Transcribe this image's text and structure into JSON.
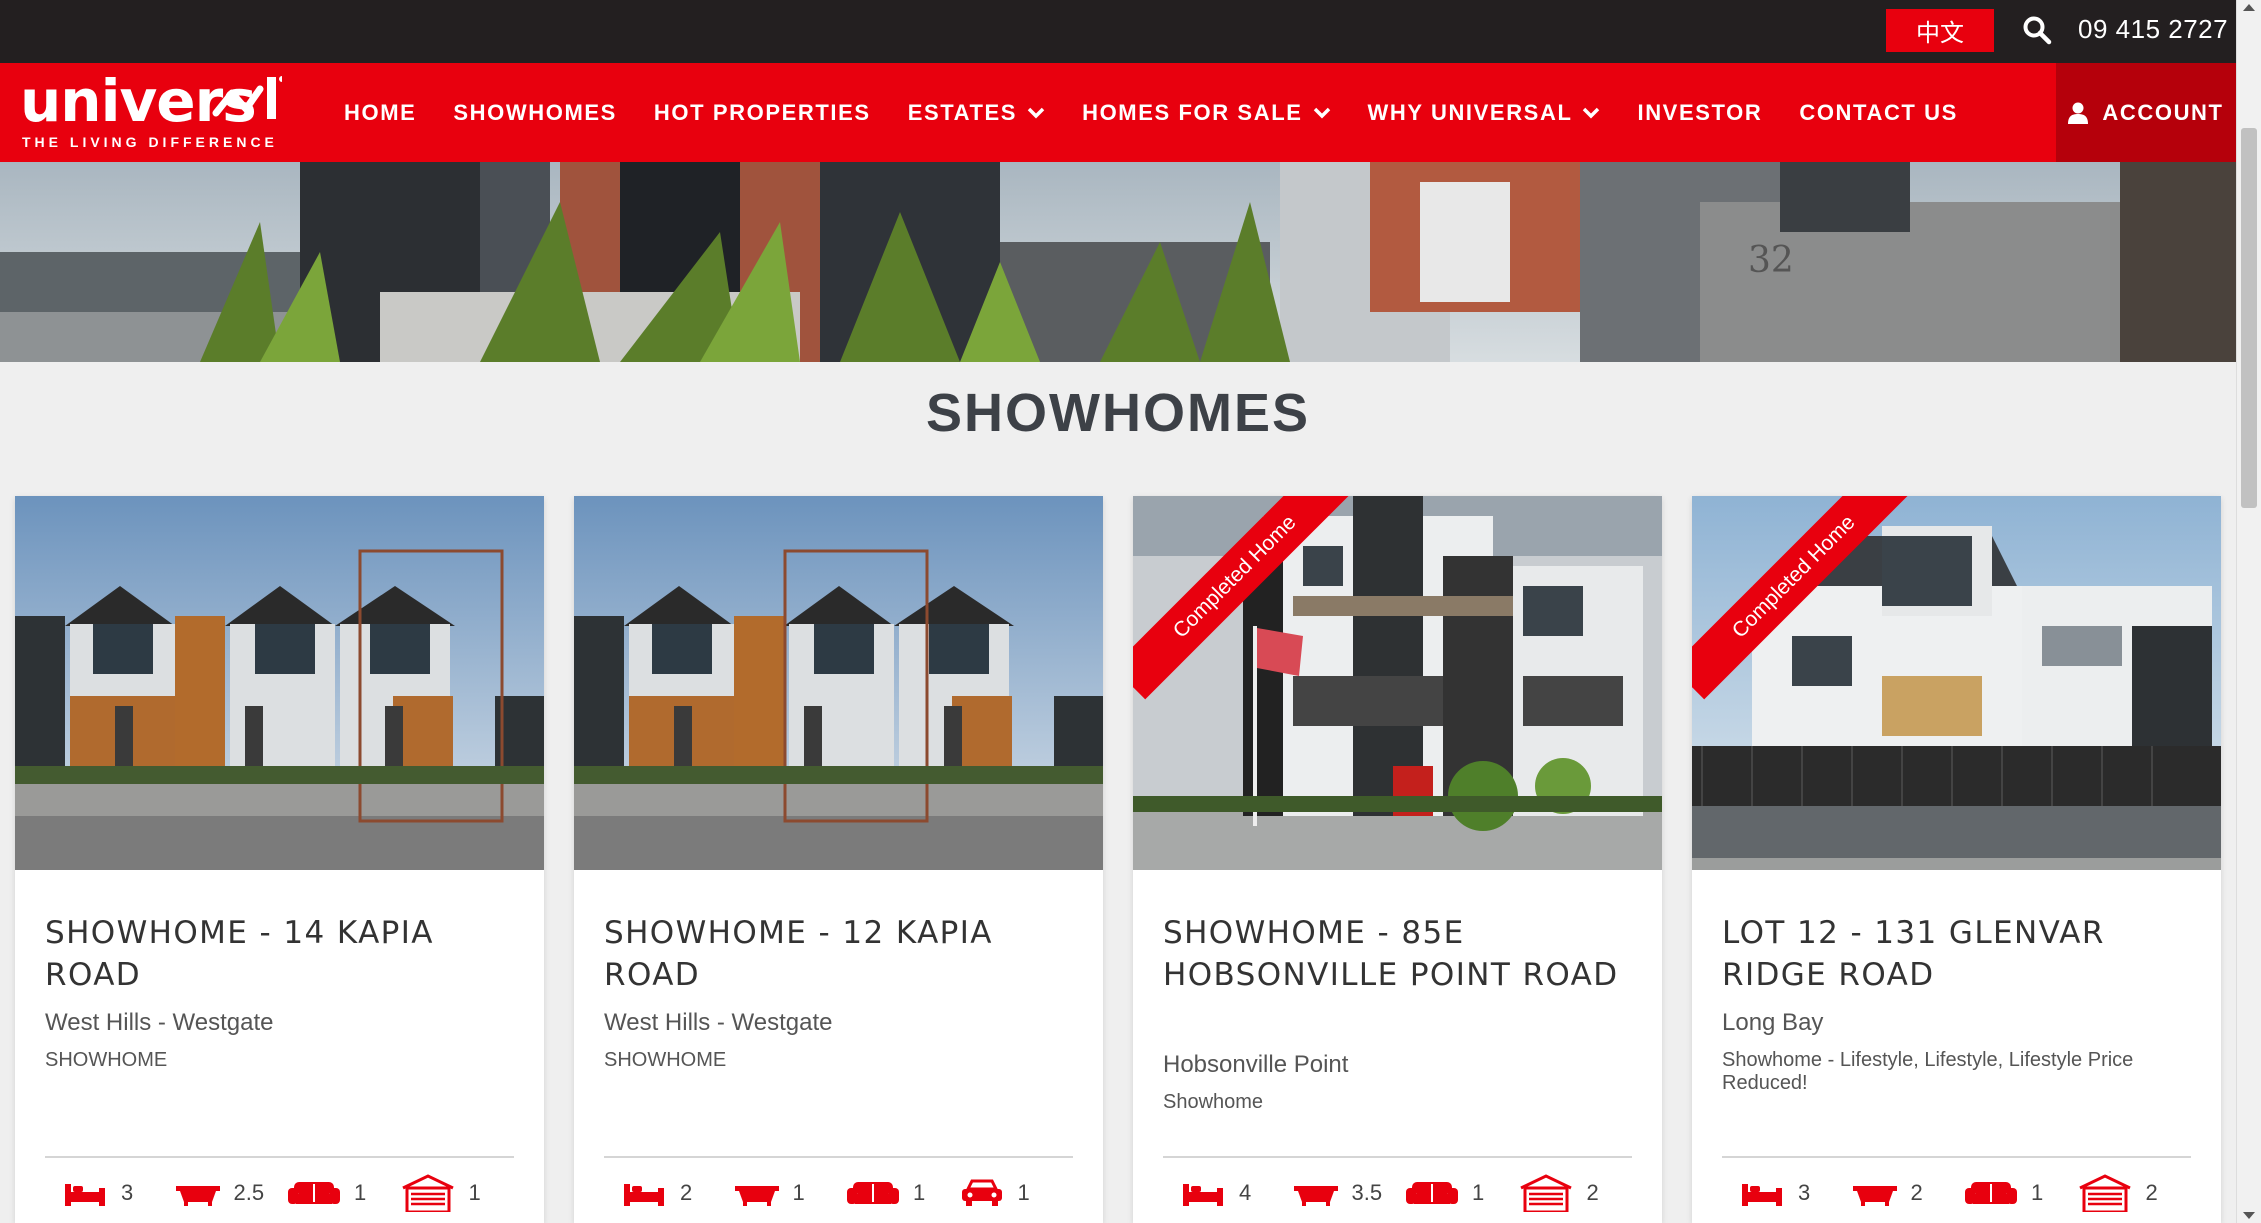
{
  "topbar": {
    "language_button": "中文",
    "phone": "09 415 2727"
  },
  "logo": {
    "wordmark": "univers l",
    "tagline": "THE LIVING DIFFERENCE"
  },
  "nav": {
    "items": [
      {
        "label": "HOME",
        "dropdown": false
      },
      {
        "label": "SHOWHOMES",
        "dropdown": false
      },
      {
        "label": "HOT PROPERTIES",
        "dropdown": false
      },
      {
        "label": "ESTATES",
        "dropdown": true
      },
      {
        "label": "HOMES FOR SALE",
        "dropdown": true
      },
      {
        "label": "WHY UNIVERSAL",
        "dropdown": true
      },
      {
        "label": "INVESTOR",
        "dropdown": false
      },
      {
        "label": "CONTACT US",
        "dropdown": false
      }
    ],
    "account": "ACCOUNT"
  },
  "page": {
    "title": "SHOWHOMES"
  },
  "cards": [
    {
      "title": "SHOWHOME - 14 KAPIA ROAD",
      "location": "West Hills - Westgate",
      "category": "SHOWHOME",
      "ribbon": "",
      "features": [
        {
          "icon": "bed-icon",
          "value": "3"
        },
        {
          "icon": "bath-icon",
          "value": "2.5"
        },
        {
          "icon": "sofa-icon",
          "value": "1"
        },
        {
          "icon": "garage-icon",
          "value": "1"
        }
      ]
    },
    {
      "title": "SHOWHOME - 12 KAPIA ROAD",
      "location": "West Hills - Westgate",
      "category": "SHOWHOME",
      "ribbon": "",
      "features": [
        {
          "icon": "bed-icon",
          "value": "2"
        },
        {
          "icon": "bath-icon",
          "value": "1"
        },
        {
          "icon": "sofa-icon",
          "value": "1"
        },
        {
          "icon": "car-icon",
          "value": "1"
        }
      ]
    },
    {
      "title": "SHOWHOME - 85E HOBSONVILLE POINT ROAD",
      "location": "Hobsonville Point",
      "category": "Showhome",
      "ribbon": "Completed Home",
      "features": [
        {
          "icon": "bed-icon",
          "value": "4"
        },
        {
          "icon": "bath-icon",
          "value": "3.5"
        },
        {
          "icon": "sofa-icon",
          "value": "1"
        },
        {
          "icon": "garage-icon",
          "value": "2"
        }
      ]
    },
    {
      "title": "LOT 12 - 131 GLENVAR RIDGE ROAD",
      "location": "Long Bay",
      "category": "Showhome - Lifestyle, Lifestyle, Lifestyle Price Reduced!",
      "ribbon": "Completed Home",
      "features": [
        {
          "icon": "bed-icon",
          "value": "3"
        },
        {
          "icon": "bath-icon",
          "value": "2"
        },
        {
          "icon": "sofa-icon",
          "value": "1"
        },
        {
          "icon": "garage-icon",
          "value": "2"
        }
      ]
    }
  ],
  "colors": {
    "brand_red": "#e8000e",
    "account_red": "#b5000b",
    "topbar": "#231f20",
    "heading": "#3d4147"
  }
}
